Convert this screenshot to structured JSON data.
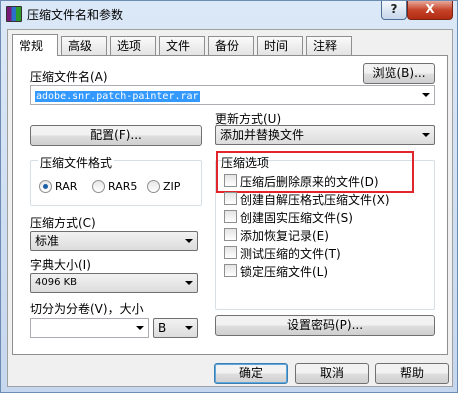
{
  "window": {
    "title": "压缩文件名和参数",
    "help_glyph": "?",
    "close_glyph": "X"
  },
  "tabs": [
    {
      "label": "常规",
      "active": true
    },
    {
      "label": "高级",
      "active": false
    },
    {
      "label": "选项",
      "active": false
    },
    {
      "label": "文件",
      "active": false
    },
    {
      "label": "备份",
      "active": false
    },
    {
      "label": "时间",
      "active": false
    },
    {
      "label": "注释",
      "active": false
    }
  ],
  "archive_name": {
    "label": "压缩文件名(A)",
    "value": "adobe.snr.patch-painter.rar",
    "browse_label": "浏览(B)..."
  },
  "profile_button": "配置(F)...",
  "update_mode": {
    "label": "更新方式(U)",
    "value": "添加并替换文件"
  },
  "archive_format": {
    "label": "压缩文件格式",
    "options": [
      {
        "label": "RAR",
        "checked": true
      },
      {
        "label": "RAR5",
        "checked": false
      },
      {
        "label": "ZIP",
        "checked": false
      }
    ]
  },
  "compression_method": {
    "label": "压缩方式(C)",
    "value": "标准"
  },
  "dictionary_size": {
    "label": "字典大小(I)",
    "value": "4096 KB"
  },
  "split_volumes": {
    "label": "切分为分卷(V)，大小",
    "value": "",
    "unit": "B"
  },
  "archive_options": {
    "label": "压缩选项",
    "items": [
      {
        "label": "压缩后删除原来的文件(D)",
        "checked": false,
        "highlighted": true
      },
      {
        "label": "创建自解压格式压缩文件(X)",
        "checked": false
      },
      {
        "label": "创建固实压缩文件(S)",
        "checked": false
      },
      {
        "label": "添加恢复记录(E)",
        "checked": false
      },
      {
        "label": "测试压缩的文件(T)",
        "checked": false
      },
      {
        "label": "锁定压缩文件(L)",
        "checked": false
      }
    ]
  },
  "password_button": "设置密码(P)...",
  "footer": {
    "ok": "确定",
    "cancel": "取消",
    "help": "帮助"
  },
  "colors": {
    "highlight_box": "#e0262b",
    "selection": "#3399ff",
    "radio_dot": "#1c5fa6"
  }
}
